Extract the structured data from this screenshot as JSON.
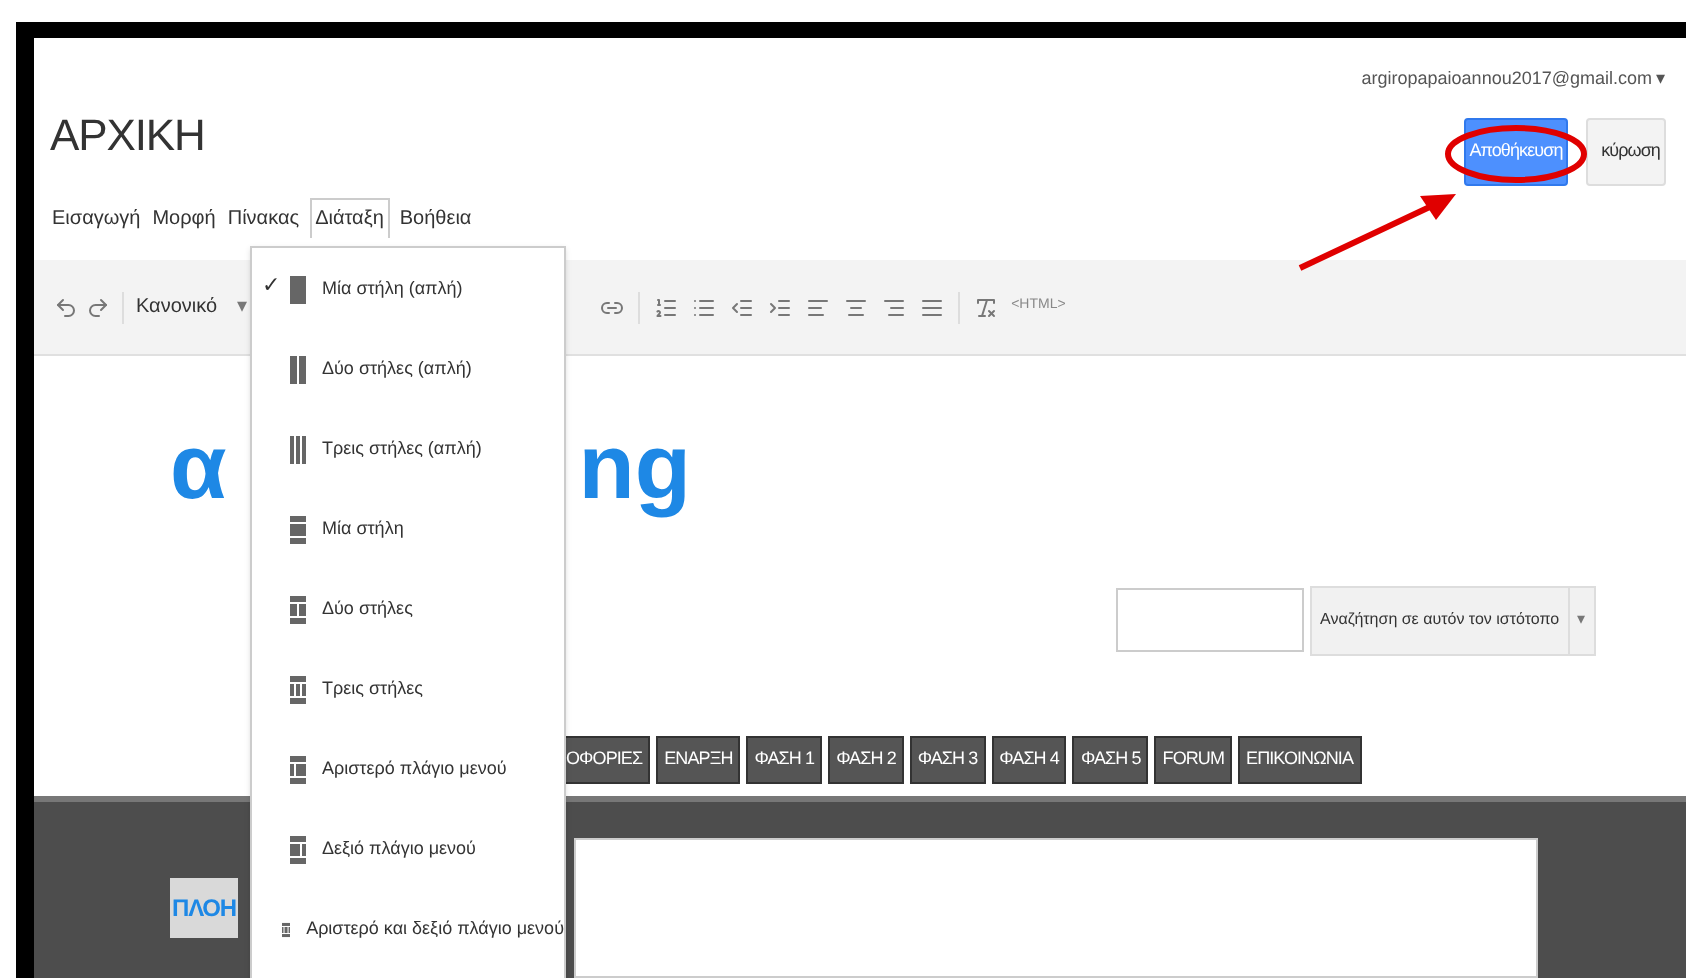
{
  "header": {
    "title": "ΑΡΧΙΚΗ",
    "account": "argiropapaioannou2017@gmail.com",
    "account_caret": "▾",
    "save_button": "Αποθήκευση",
    "cancel_button": "κύρωση"
  },
  "menu": [
    {
      "label": "Εισαγωγή",
      "selected": false
    },
    {
      "label": "Μορφή",
      "selected": false
    },
    {
      "label": "Πίνακας",
      "selected": false
    },
    {
      "label": "Διάταξη",
      "selected": true
    },
    {
      "label": "Βοήθεια",
      "selected": false
    }
  ],
  "toolbar": {
    "style": "Κανονικό",
    "style_caret": "▾",
    "html": "<HTML>"
  },
  "layout_check": "✓",
  "layout_menu": [
    {
      "label": "Μία στήλη (απλή)",
      "checked": true,
      "kind": "one"
    },
    {
      "label": "Δύο στήλες (απλή)",
      "checked": false,
      "kind": "two"
    },
    {
      "label": "Τρεις στήλες (απλή)",
      "checked": false,
      "kind": "three"
    },
    {
      "label": "Μία στήλη",
      "checked": false,
      "kind": "page1"
    },
    {
      "label": "Δύο στήλες",
      "checked": false,
      "kind": "page2"
    },
    {
      "label": "Τρεις στήλες",
      "checked": false,
      "kind": "page3"
    },
    {
      "label": "Αριστερό πλάγιο μενού",
      "checked": false,
      "kind": "leftbar"
    },
    {
      "label": "Δεξιό πλάγιο μενού",
      "checked": false,
      "kind": "rightbar"
    },
    {
      "label": "Αριστερό και δεξιό πλάγιο μενού",
      "checked": false,
      "kind": "bothbars"
    }
  ],
  "logo": {
    "left": "α",
    "right": "ng"
  },
  "search": {
    "button": "Αναζήτηση σε αυτόν τον ιστότοπο",
    "caret": "▾"
  },
  "nav": [
    "ΟΦΟΡΙΕΣ",
    "ΕΝΑΡΞΗ",
    "ΦΑΣΗ 1",
    "ΦΑΣΗ 2",
    "ΦΑΣΗ 3",
    "ΦΑΣΗ 4",
    "ΦΑΣΗ 5",
    "FORUM",
    "ΕΠΙΚΟΙΝΩΝΙΑ"
  ],
  "sidebar": {
    "heading": "ΠΛΟΗ"
  }
}
